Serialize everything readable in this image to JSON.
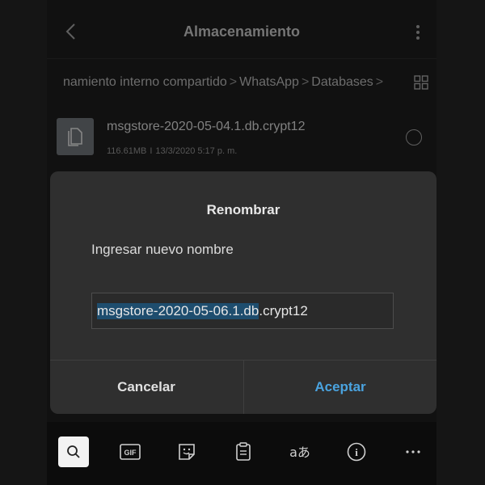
{
  "header": {
    "title": "Almacenamiento",
    "back_icon": "chevron-left-icon",
    "menu_icon": "more-vertical-icon"
  },
  "breadcrumb": {
    "items": [
      "namiento interno compartido",
      "WhatsApp",
      "Databases"
    ],
    "separator": ">",
    "view_icon": "grid-view-icon"
  },
  "file": {
    "name": "msgstore-2020-05-04.1.db.crypt12",
    "size": "116.61MB",
    "meta_separator": "I",
    "date": "13/3/2020 5:17 p. m.",
    "icon": "document-icon"
  },
  "dialog": {
    "title": "Renombrar",
    "label": "Ingresar nuevo nombre",
    "input_selected_part": "msgstore-2020-05-06.1.db",
    "input_rest": ".crypt12",
    "cancel_label": "Cancelar",
    "accept_label": "Aceptar",
    "accent_color": "#4aa3df"
  },
  "keyboard_toolbar": {
    "gif_label": "GIF",
    "translate_glyph": "aあ",
    "info_glyph": "i",
    "more_glyph": "···",
    "icons": [
      "search-icon",
      "gif-icon",
      "sticker-icon",
      "clipboard-icon",
      "translate-icon",
      "info-icon",
      "more-horizontal-icon"
    ]
  }
}
